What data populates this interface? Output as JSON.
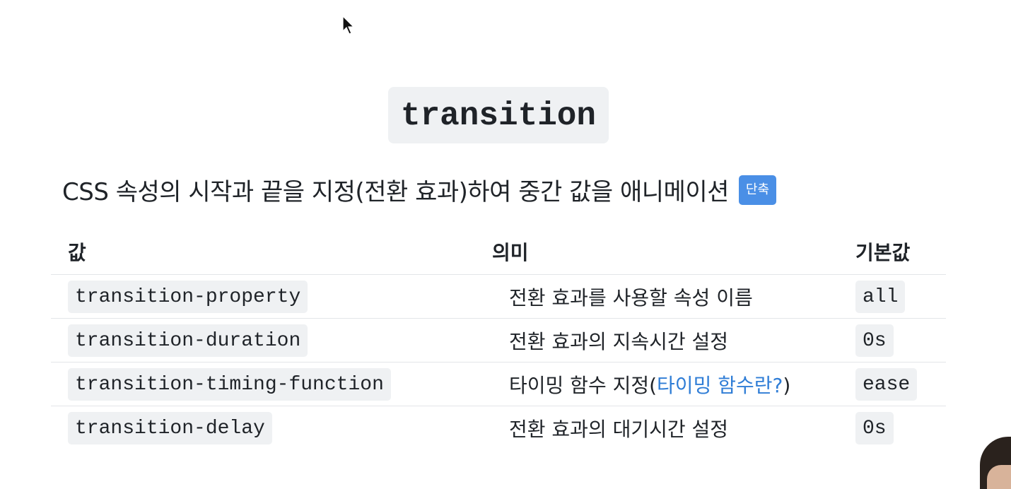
{
  "title": "transition",
  "subtitle": "CSS 속성의 시작과 끝을 지정(전환 효과)하여 중간 값을 애니메이션",
  "badge": "단축",
  "table": {
    "headers": {
      "value": "값",
      "meaning": "의미",
      "default": "기본값"
    },
    "rows": [
      {
        "value": "transition-property",
        "meaning": "전환 효과를 사용할 속성 이름",
        "default": "all"
      },
      {
        "value": "transition-duration",
        "meaning": "전환 효과의 지속시간 설정",
        "default": "0s"
      },
      {
        "value": "transition-timing-function",
        "meaning_prefix": "타이밍 함수 지정(",
        "meaning_link": "타이밍 함수란?",
        "meaning_suffix": ")",
        "default": "ease"
      },
      {
        "value": "transition-delay",
        "meaning": "전환 효과의 대기시간 설정",
        "default": "0s"
      }
    ]
  },
  "colors": {
    "badge_bg": "#4a8fe6",
    "link": "#2f7dd6",
    "code_bg": "#eff1f3"
  },
  "icons": {
    "cursor": "mouse-pointer-icon"
  }
}
